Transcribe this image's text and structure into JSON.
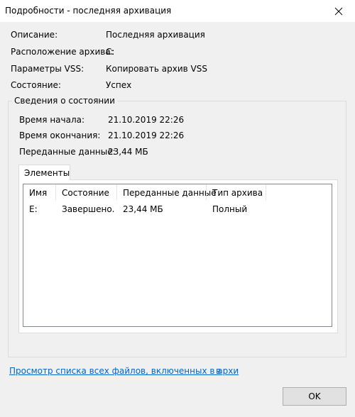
{
  "window": {
    "title": "Подробности - последняя архивация",
    "close_icon": "close-icon"
  },
  "details": [
    {
      "label": "Описание:",
      "value": "Последняя архивация"
    },
    {
      "label": "Расположение архива:",
      "value": "C:"
    },
    {
      "label": "Параметры VSS:",
      "value": "Копировать архив VSS"
    },
    {
      "label": "Состояние:",
      "value": "Успех"
    }
  ],
  "status_group": {
    "title": "Сведения о состоянии",
    "rows": [
      {
        "label": "Время начала:",
        "value": "21.10.2019 22:26"
      },
      {
        "label": "Время окончания:",
        "value": "21.10.2019 22:26"
      },
      {
        "label": "Переданные данные:",
        "value": "23,44 МБ"
      }
    ]
  },
  "tabs": [
    {
      "label": "Элементы",
      "selected": true
    }
  ],
  "items_table": {
    "columns": [
      "Имя",
      "Состояние",
      "Переданные данные",
      "Тип архива"
    ],
    "rows": [
      [
        "E:",
        "Завершено.",
        "23,44 МБ",
        "Полный"
      ]
    ]
  },
  "link": {
    "text": "Просмотр списка всех файлов, включенных в архи",
    "tail": "в"
  },
  "buttons": {
    "ok_label": "OK"
  },
  "colors": {
    "titlebar": "#ffffff",
    "dialog_bg": "#f0f0f0",
    "link": "#0066cc"
  }
}
